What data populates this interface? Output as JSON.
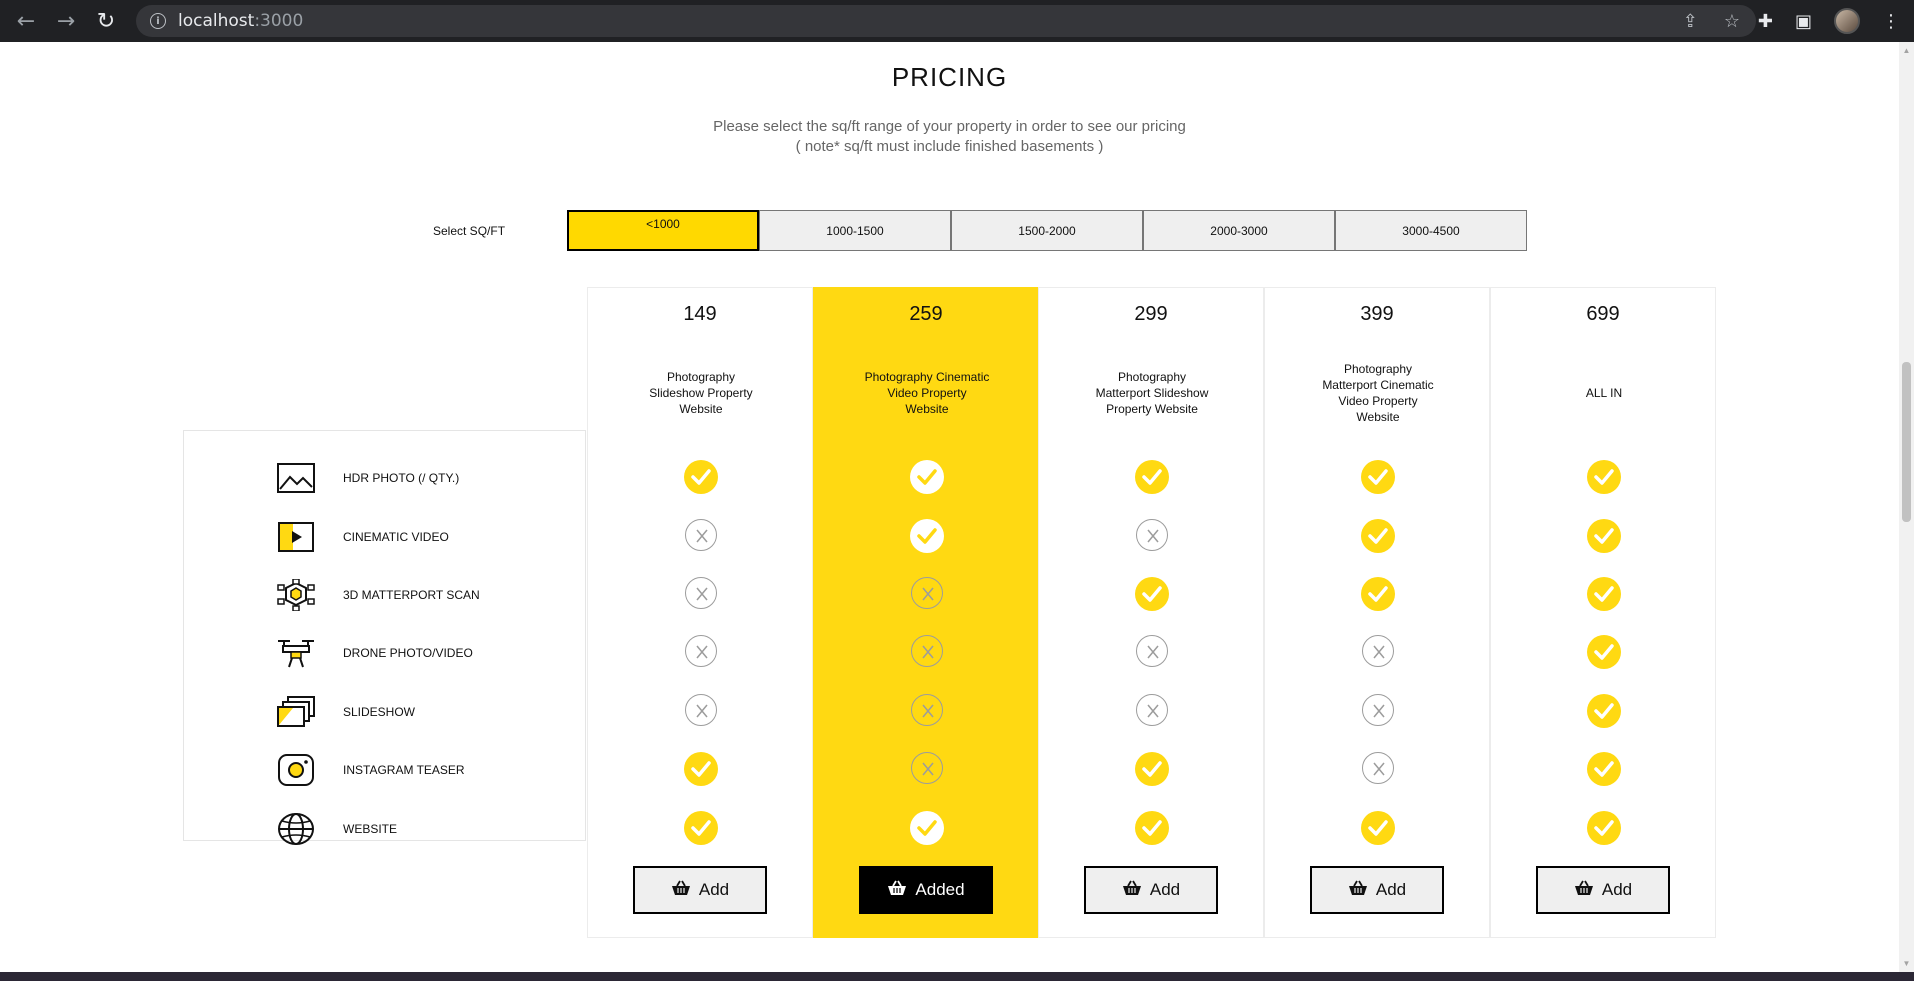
{
  "browser": {
    "url_host": "localhost",
    "url_port": ":3000"
  },
  "page": {
    "title": "PRICING",
    "subtitle_line1": "Please select the sq/ft range of your property in order to see our pricing",
    "subtitle_line2": "( note* sq/ft must include finished basements )"
  },
  "sqft": {
    "label": "Select SQ/FT",
    "selected_index": 0,
    "options": [
      "<1000",
      "1000-1500",
      "1500-2000",
      "2000-3000",
      "3000-4500"
    ]
  },
  "features": [
    {
      "label": "HDR PHOTO (/ QTY.)",
      "icon": "photo-icon"
    },
    {
      "label": "CINEMATIC VIDEO",
      "icon": "video-icon"
    },
    {
      "label": "3D MATTERPORT SCAN",
      "icon": "matterport-icon"
    },
    {
      "label": "DRONE PHOTO/VIDEO",
      "icon": "drone-icon"
    },
    {
      "label": "SLIDESHOW",
      "icon": "slideshow-icon"
    },
    {
      "label": "INSTAGRAM TEASER",
      "icon": "instagram-icon"
    },
    {
      "label": "WEBSITE",
      "icon": "globe-icon"
    }
  ],
  "plans": [
    {
      "price": "149",
      "description": "Photography\nSlideshow Property\nWebsite",
      "features": [
        true,
        false,
        false,
        false,
        false,
        true,
        true
      ],
      "button": "Add",
      "added": false
    },
    {
      "price": "259",
      "description": "Photography Cinematic\nVideo Property\nWebsite",
      "features": [
        true,
        true,
        false,
        false,
        false,
        false,
        true
      ],
      "button": "Added",
      "added": true
    },
    {
      "price": "299",
      "description": "Photography\nMatterport Slideshow\nProperty Website",
      "features": [
        true,
        false,
        true,
        false,
        false,
        true,
        true
      ],
      "button": "Add",
      "added": false
    },
    {
      "price": "399",
      "description": "Photography\nMatterport Cinematic\nVideo Property\nWebsite",
      "features": [
        true,
        true,
        true,
        false,
        false,
        false,
        true
      ],
      "button": "Add",
      "added": false
    },
    {
      "price": "699",
      "description": "ALL IN",
      "features": [
        true,
        true,
        true,
        true,
        true,
        true,
        true
      ],
      "button": "Add",
      "added": false
    }
  ],
  "colors": {
    "accent": "#ffd912",
    "button_selected": "#000000"
  }
}
